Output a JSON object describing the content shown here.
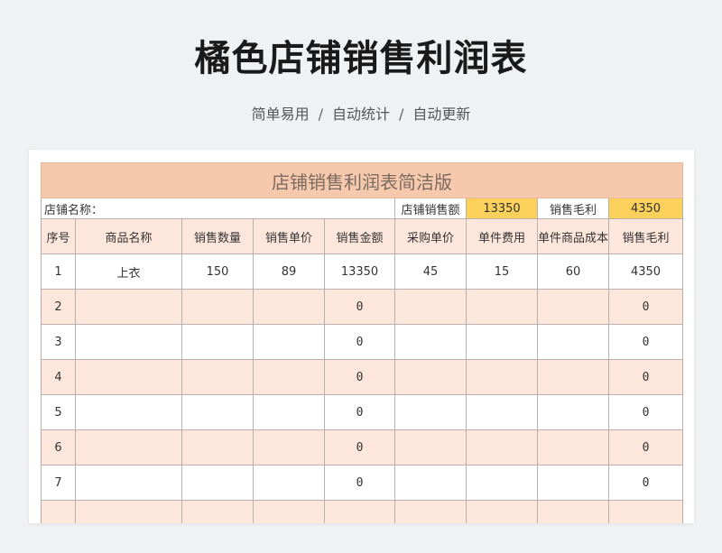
{
  "title": "橘色店铺销售利润表",
  "subtitle": [
    "简单易用",
    "自动统计",
    "自动更新"
  ],
  "separator": "/",
  "sheet": {
    "banner": "店铺销售利润表简洁版",
    "info": {
      "store_name_label": "店铺名称：",
      "sales_total_label": "店铺销售额",
      "sales_total_value": "13350",
      "gross_profit_label": "销售毛利",
      "gross_profit_value": "4350"
    },
    "headers": [
      "序号",
      "商品名称",
      "销售数量",
      "销售单价",
      "销售金额",
      "采购单价",
      "单件费用",
      "单件商品成本",
      "销售毛利"
    ],
    "rows": [
      [
        "1",
        "上衣",
        "150",
        "89",
        "13350",
        "45",
        "15",
        "60",
        "4350"
      ],
      [
        "2",
        "",
        "",
        "",
        "0",
        "",
        "",
        "",
        "0"
      ],
      [
        "3",
        "",
        "",
        "",
        "0",
        "",
        "",
        "",
        "0"
      ],
      [
        "4",
        "",
        "",
        "",
        "0",
        "",
        "",
        "",
        "0"
      ],
      [
        "5",
        "",
        "",
        "",
        "0",
        "",
        "",
        "",
        "0"
      ],
      [
        "6",
        "",
        "",
        "",
        "0",
        "",
        "",
        "",
        "0"
      ],
      [
        "7",
        "",
        "",
        "",
        "0",
        "",
        "",
        "",
        "0"
      ],
      [
        "",
        "",
        "",
        "",
        "",
        "",
        "",
        "",
        ""
      ]
    ]
  },
  "colors": {
    "banner": "#f6c9ac",
    "header": "#fde7dc",
    "highlight": "#fbd15b",
    "background": "#f0f1f3"
  }
}
